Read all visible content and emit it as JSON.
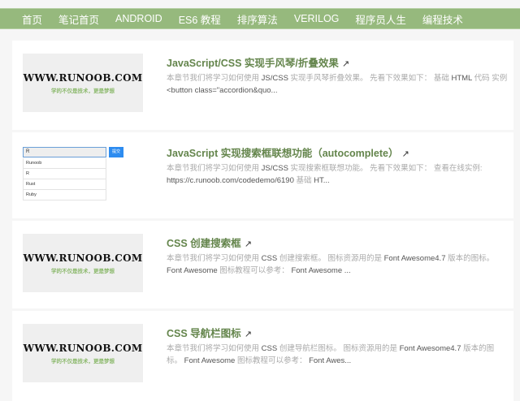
{
  "nav": {
    "items": [
      "首页",
      "笔记首页",
      "ANDROID",
      "ES6 教程",
      "排序算法",
      "VERILOG",
      "程序员人生",
      "编程技术"
    ],
    "active": "编程技术"
  },
  "logo": {
    "text": "WWW.RUNOOB.COM",
    "slogan": "学的不仅是技术，更是梦想"
  },
  "autocomplete": {
    "input": "R",
    "button": "提交",
    "options": [
      "Runoob",
      "R",
      "Rust",
      "Ruby"
    ]
  },
  "articles": [
    {
      "title": "JavaScript/CSS 实现手风琴/折叠效果",
      "desc": [
        "本章节我们将学习如何使用 ",
        "JS/CSS",
        " 实现手风琴折叠效果。 先看下效果如下： 基础 ",
        "HTML",
        " 代码 实例 ",
        "<button class=\"accordion&quo..."
      ]
    },
    {
      "title": "JavaScript 实现搜索框联想功能（autocomplete）",
      "desc": [
        "本章节我们将学习如何使用 ",
        "JS/CSS",
        " 实现搜索框联想功能。 先看下效果如下： 查看在线实例: ",
        "https://c.runoob.com/codedemo/6190",
        " 基础 ",
        "HT..."
      ]
    },
    {
      "title": "CSS 创建搜索框",
      "desc": [
        "本章节我们将学习如何使用 ",
        "CSS",
        " 创建搜索框。 图标资源用的是 ",
        "Font Awesome4.7",
        " 版本的图标。 ",
        "Font Awesome",
        " 图标教程可以参考： ",
        "Font Awesome ..."
      ]
    },
    {
      "title": "CSS 导航栏图标",
      "desc": [
        "本章节我们将学习如何使用 ",
        "CSS",
        " 创建导航栏图标。 图标资源用的是 ",
        "Font Awesome4.7",
        " 版本的图标。 ",
        "Font Awesome",
        " 图标教程可以参考： ",
        "Font Awes..."
      ]
    }
  ],
  "colors": {
    "nav": "#96b97d",
    "title": "#64854c"
  }
}
